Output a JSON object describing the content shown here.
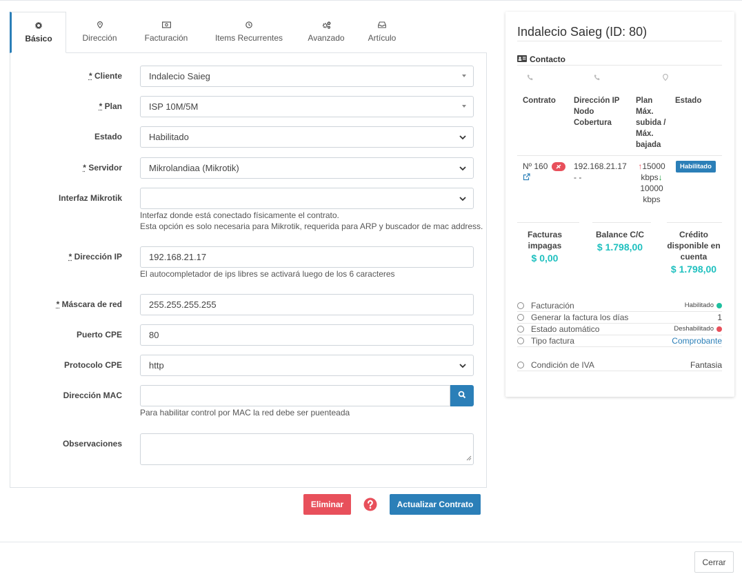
{
  "tabs": [
    {
      "label": "Básico",
      "icon": "gear-icon",
      "active": true
    },
    {
      "label": "Dirección",
      "icon": "map-marker-icon"
    },
    {
      "label": "Facturación",
      "icon": "money-bill-icon"
    },
    {
      "label": "Items Recurrentes",
      "icon": "clock-icon"
    },
    {
      "label": "Avanzado",
      "icon": "cogs-icon"
    },
    {
      "label": "Artículo",
      "icon": "inbox-icon"
    }
  ],
  "form": {
    "cliente": {
      "req": "*",
      "label": "Cliente",
      "value": "Indalecio Saieg"
    },
    "plan": {
      "req": "*",
      "label": "Plan",
      "value": "ISP 10M/5M"
    },
    "estado": {
      "label": "Estado",
      "value": "Habilitado"
    },
    "servidor": {
      "req": "*",
      "label": "Servidor",
      "value": "Mikrolandiaa (Mikrotik)"
    },
    "interfaz": {
      "label": "Interfaz Mikrotik",
      "value": "",
      "help1": "Interfaz donde está conectado físicamente el contrato.",
      "help2": "Esta opción es solo necesaria para Mikrotik, requerida para ARP y buscador de mac address."
    },
    "ip": {
      "req": "*",
      "label": "Dirección IP",
      "value": "192.168.21.17",
      "help": "El autocompletador de ips libres se activará luego de los 6 caracteres"
    },
    "mascara": {
      "req": "*",
      "label": "Máscara de red",
      "value": "255.255.255.255"
    },
    "puerto": {
      "label": "Puerto CPE",
      "value": "80"
    },
    "protocolo": {
      "label": "Protocolo CPE",
      "value": "http"
    },
    "mac": {
      "label": "Dirección MAC",
      "value": "",
      "help": "Para habilitar control por MAC la red debe ser puenteada"
    },
    "observaciones": {
      "label": "Observaciones",
      "value": ""
    }
  },
  "actions": {
    "delete": "Eliminar",
    "update": "Actualizar Contrato",
    "close": "Cerrar"
  },
  "card": {
    "title": "Indalecio Saieg (ID: 80)",
    "contact_heading": "Contacto",
    "headers": {
      "contrato": "Contrato",
      "dir1": "Dirección IP",
      "dir2": "Nodo",
      "dir3": "Cobertura",
      "plan1": "Plan",
      "plan2": "Máx.",
      "plan3": "subida /",
      "plan4": "Máx.",
      "plan5": "bajada",
      "estado": "Estado"
    },
    "row": {
      "contrato": "Nº 160",
      "ip": "192.168.21.17",
      "nodo": "- -",
      "up_value": "15000",
      "up_unit": "kbps",
      "down_value": "10000",
      "down_unit": "kbps",
      "estado": "Habilitado"
    },
    "stats": {
      "facturas1": "Facturas",
      "facturas2": "impagas",
      "facturas_value": "$ 0,00",
      "balance_label": "Balance C/C",
      "balance_value": "$ 1.798,00",
      "credito1": "Crédito",
      "credito2": "disponible en",
      "credito3": "cuenta",
      "credito_value": "$ 1.798,00"
    },
    "info": [
      {
        "label": "Facturación",
        "value": "Habilitado",
        "dot": "#1fc0a0"
      },
      {
        "label": "Generar la factura los días",
        "value": "1"
      },
      {
        "label": "Estado automático",
        "value": "Deshabilitado",
        "dot": "#e8505b"
      },
      {
        "label": "Tipo factura",
        "value": "Comprobante"
      },
      {
        "label": "Condición de IVA",
        "value": "Fantasia"
      }
    ]
  },
  "colors": {
    "accent": "#2b7fb8",
    "danger": "#e8505b",
    "teal": "#1fc0bf"
  }
}
